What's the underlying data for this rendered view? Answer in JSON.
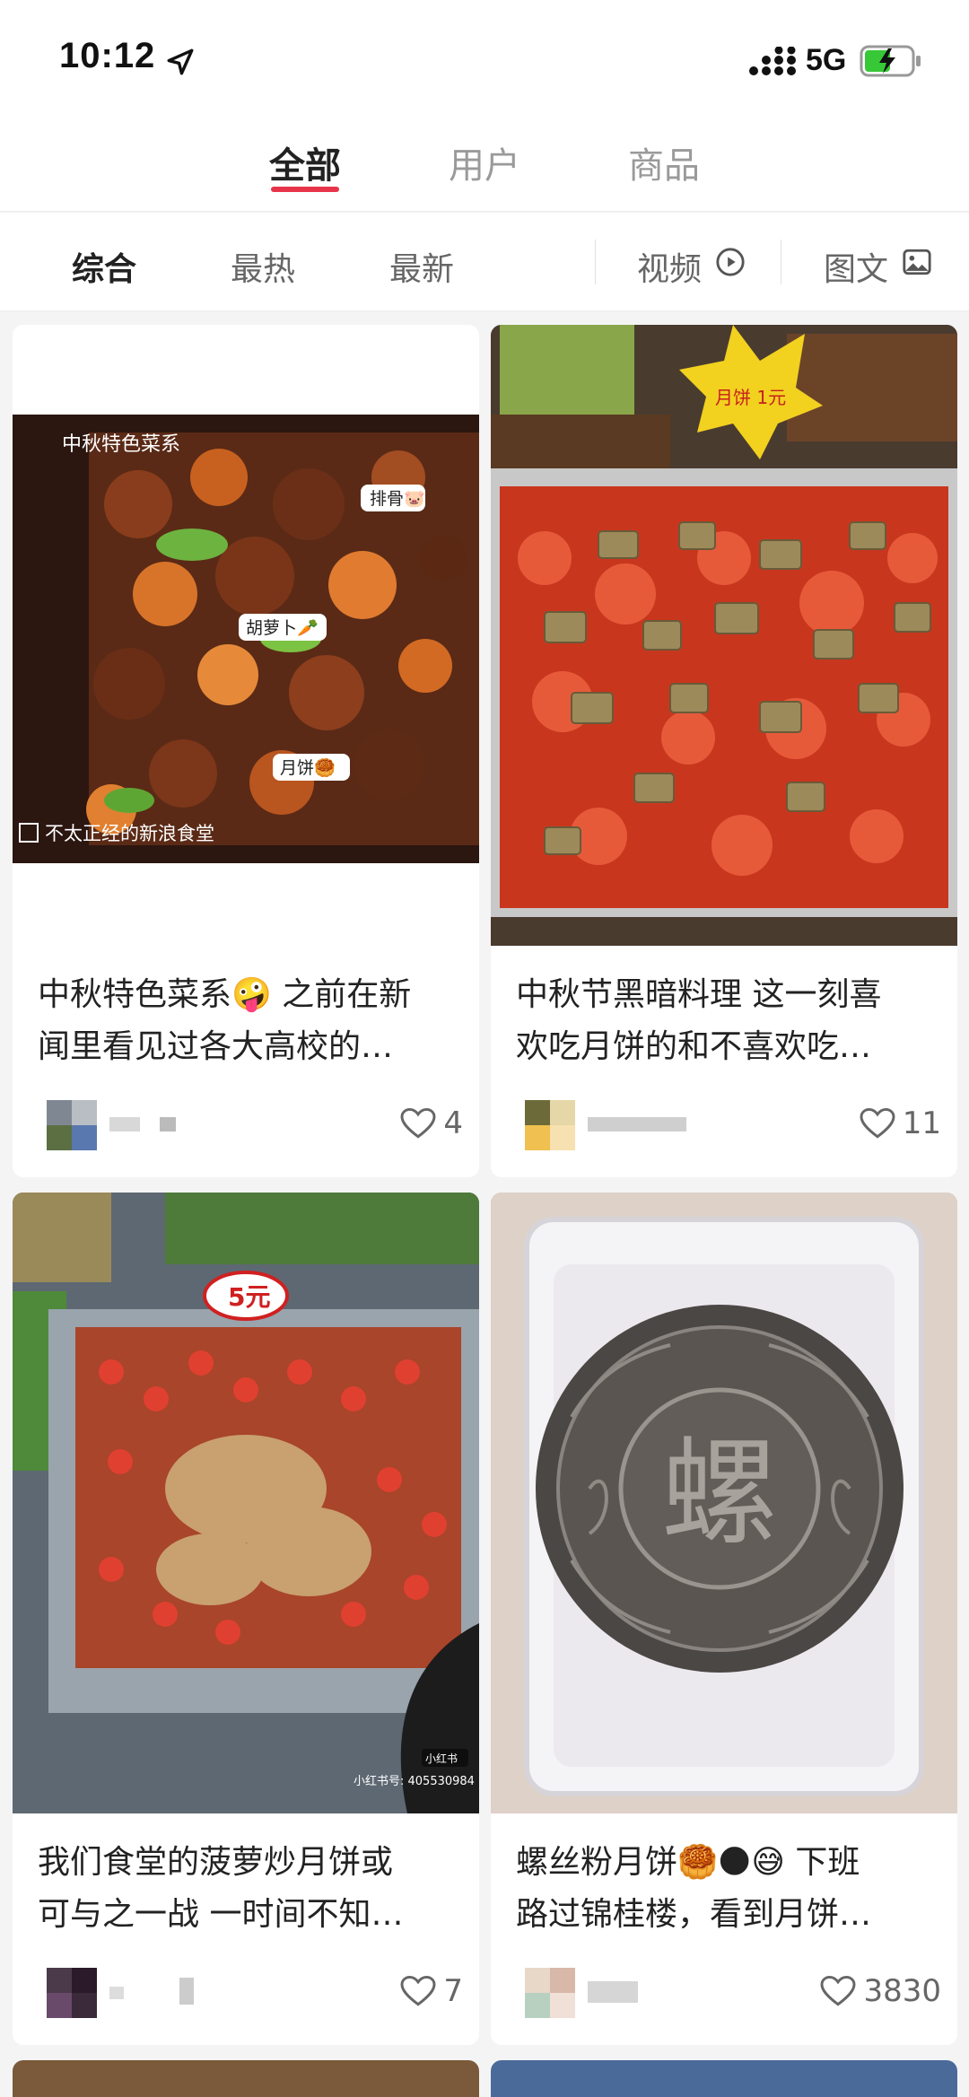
{
  "status_bar": {
    "time": "10:12",
    "network": "5G",
    "icons": [
      "location-arrow-icon",
      "signal-icon",
      "battery-charging-icon"
    ]
  },
  "main_tabs": [
    {
      "label": "全部",
      "active": true
    },
    {
      "label": "用户",
      "active": false
    },
    {
      "label": "商品",
      "active": false
    }
  ],
  "filters": {
    "sort": [
      "综合",
      "最热",
      "最新"
    ],
    "video_label": "视频",
    "image_text_label": "图文"
  },
  "colors": {
    "accent": "#e8344a",
    "text_primary": "#222222",
    "text_secondary": "#9a9a9a"
  },
  "posts": [
    {
      "title_line1": "中秋特色菜系🤪 之前在新",
      "title_line2": "闻里看见过各大高校的…",
      "likes": "4",
      "image_overlays": {
        "corner_label": "中秋特色菜系",
        "tag1": "排骨🐷",
        "tag2": "胡萝卜🥕",
        "tag3": "月饼🥮",
        "watermark": "不太正经的新浪食堂"
      }
    },
    {
      "title_line1": "中秋节黑暗料理 这一刻喜",
      "title_line2": "欢吃月饼的和不喜欢吃…",
      "likes": "11",
      "image_overlays": {
        "sign": "月饼 1元"
      }
    },
    {
      "title_line1": "我们食堂的菠萝炒月饼或",
      "title_line2": "可与之一战 一时间不知…",
      "likes": "7",
      "image_overlays": {
        "price_tag": "5元",
        "badge": "小红书",
        "account": "小红书号: 405530984"
      }
    },
    {
      "title_line1": "螺丝粉月饼🥮🌑😅 下班",
      "title_line2": "路过锦桂楼，看到月饼…",
      "likes": "3830",
      "image_overlays": {
        "mooncake_character": "螺"
      }
    }
  ]
}
